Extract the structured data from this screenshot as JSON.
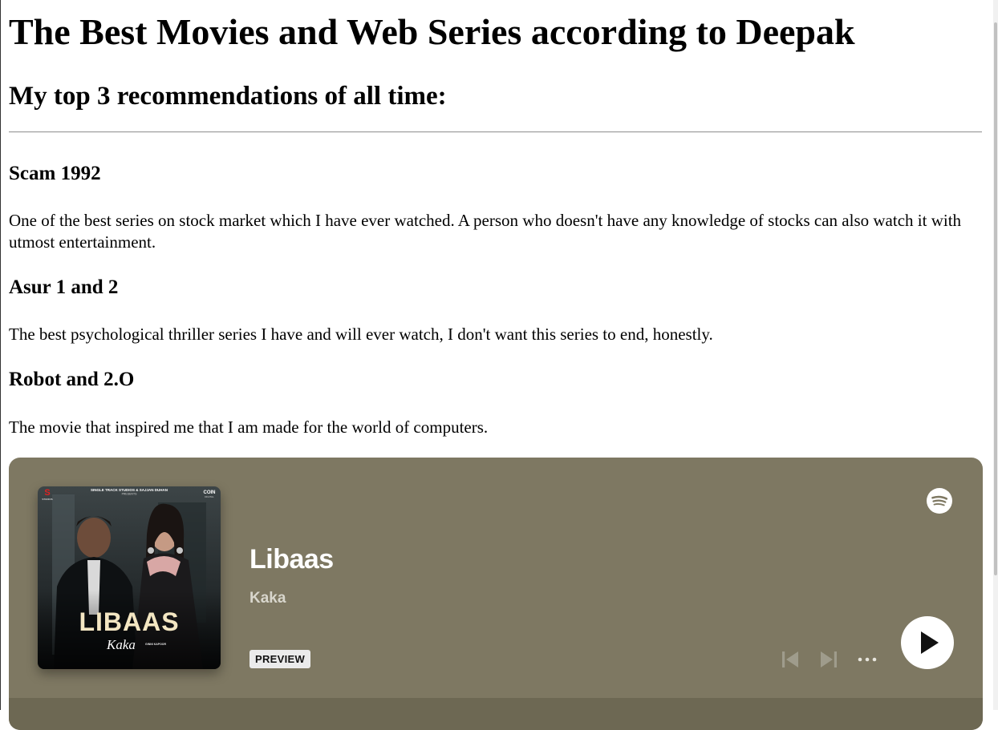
{
  "page": {
    "title": "The Best Movies and Web Series according to Deepak",
    "subtitle": "My top 3 recommendations of all time:",
    "recommendations": [
      {
        "title": "Scam 1992",
        "description": "One of the best series on stock market which I have ever watched. A person who doesn't have any knowledge of stocks can also watch it with utmost entertainment."
      },
      {
        "title": "Asur 1 and 2",
        "description": "The best psychological thriller series I have and will ever watch, I don't want this series to end, honestly."
      },
      {
        "title": "Robot and 2.O",
        "description": "The movie that inspired me that I am made for the world of computers."
      }
    ]
  },
  "spotify_embed": {
    "background_color": "#7e7862",
    "track_title": "Libaas",
    "artist": "Kaka",
    "preview_label": "PREVIEW",
    "cover": {
      "top_credit": "SINGLE TRACK STUDIOS & SAJJAN DUHAN",
      "presents": "PRESENTS",
      "left_logo": "S",
      "left_logo_sub": "STUDIOS",
      "right_logo": "COIN",
      "right_logo_sub": "DIGITAL",
      "title_text": "LIBAAS",
      "signature": "Kaka",
      "credit_line": "GINNI KAPOOR"
    },
    "icons": {
      "logo": "spotify-icon",
      "previous": "skip-previous-icon",
      "next": "skip-next-icon",
      "more": "more-options-icon",
      "play": "play-icon"
    }
  }
}
